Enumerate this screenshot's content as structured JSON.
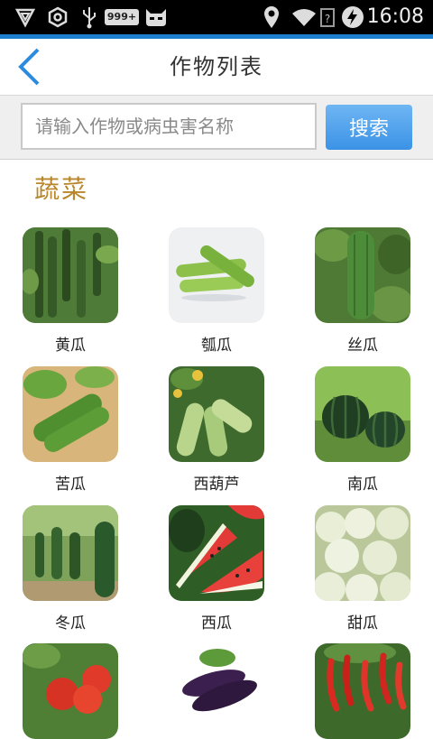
{
  "status_bar": {
    "time": "16:08",
    "icons": [
      "vpn-shield-icon",
      "target-icon",
      "usb-icon",
      "notification-999-icon",
      "android-cat-icon",
      "location-pin-icon",
      "wifi-icon",
      "signal-icon",
      "charging-icon"
    ],
    "badge": "999+"
  },
  "header": {
    "title": "作物列表",
    "back_icon": "chevron-left-icon"
  },
  "search": {
    "placeholder": "请输入作物或病虫害名称",
    "value": "",
    "button_label": "搜索"
  },
  "section": {
    "title": "蔬菜"
  },
  "crops": [
    {
      "name": "黄瓜",
      "icon": "cucumber-photo"
    },
    {
      "name": "瓠瓜",
      "icon": "bottle-gourd-photo"
    },
    {
      "name": "丝瓜",
      "icon": "luffa-photo"
    },
    {
      "name": "苦瓜",
      "icon": "bitter-melon-photo"
    },
    {
      "name": "西葫芦",
      "icon": "zucchini-photo"
    },
    {
      "name": "南瓜",
      "icon": "pumpkin-photo"
    },
    {
      "name": "冬瓜",
      "icon": "wax-gourd-photo"
    },
    {
      "name": "西瓜",
      "icon": "watermelon-photo"
    },
    {
      "name": "甜瓜",
      "icon": "melon-photo"
    },
    {
      "name": "",
      "icon": "tomato-photo"
    },
    {
      "name": "",
      "icon": "eggplant-photo"
    },
    {
      "name": "",
      "icon": "chili-pepper-photo"
    }
  ],
  "colors": {
    "accent": "#1e7fd0",
    "section_title": "#b8862b",
    "button": "#4aa0ec"
  }
}
